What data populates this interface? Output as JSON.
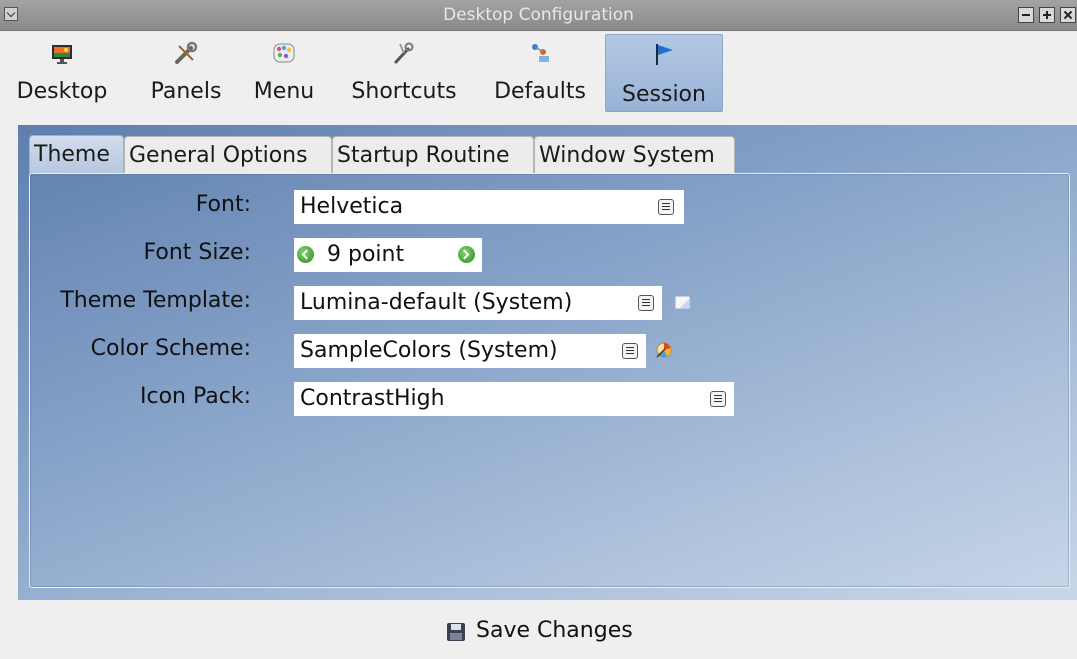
{
  "window": {
    "title": "Desktop Configuration"
  },
  "toolbar": {
    "items": [
      {
        "label": "Desktop",
        "icon": "desktop-wallpaper-icon"
      },
      {
        "label": "Panels",
        "icon": "wrench-screwdriver-icon"
      },
      {
        "label": "Menu",
        "icon": "palette-menu-icon"
      },
      {
        "label": "Shortcuts",
        "icon": "keyboard-tools-icon"
      },
      {
        "label": "Defaults",
        "icon": "default-apps-icon"
      },
      {
        "label": "Session",
        "icon": "flag-icon"
      }
    ],
    "active": "Session"
  },
  "tabs": {
    "items": [
      {
        "label": "Theme"
      },
      {
        "label": "General Options"
      },
      {
        "label": "Startup Routine"
      },
      {
        "label": "Window System"
      }
    ],
    "active": "Theme"
  },
  "form": {
    "font": {
      "label": "Font:",
      "value": "Helvetica"
    },
    "font_size": {
      "label": "Font Size:",
      "value": "9 point"
    },
    "theme_template": {
      "label": "Theme Template:",
      "value": "Lumina-default (System)",
      "side_icon": "edit-document-icon"
    },
    "color_scheme": {
      "label": "Color Scheme:",
      "value": "SampleColors (System)",
      "side_icon": "color-wheel-icon"
    },
    "icon_pack": {
      "label": "Icon Pack:",
      "value": "ContrastHigh"
    }
  },
  "footer": {
    "save_label": "Save Changes"
  },
  "colors": {
    "accent_active": "#a8bee0",
    "panel_gradient_start": "#5e7fae",
    "panel_gradient_end": "#c8d6e8",
    "spin_arrow": "#2e8b22"
  }
}
